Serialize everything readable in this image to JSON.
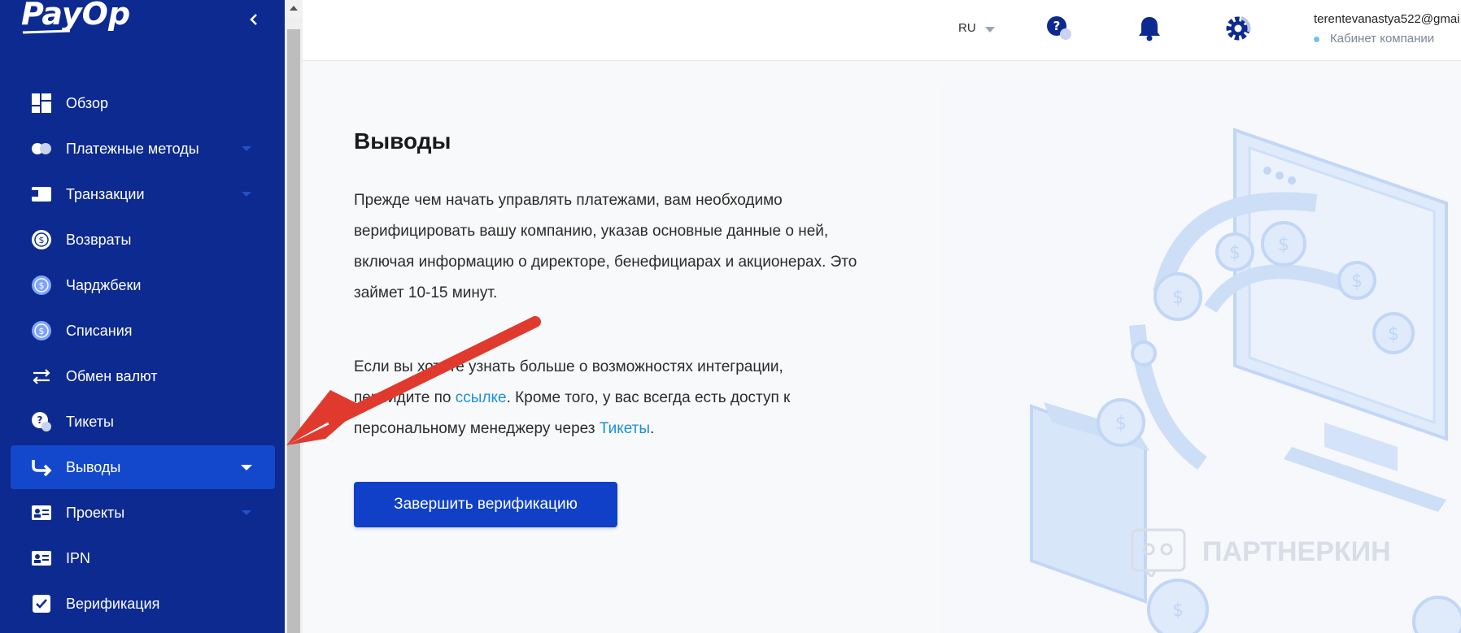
{
  "brand": {
    "logo_text": "PayOp"
  },
  "sidebar": {
    "items": [
      {
        "label": "Обзор",
        "icon": "dashboard-icon",
        "has_caret": false,
        "active": false
      },
      {
        "label": "Платежные методы",
        "icon": "payment-methods-icon",
        "has_caret": true,
        "active": false
      },
      {
        "label": "Транзакции",
        "icon": "wallet-icon",
        "has_caret": true,
        "active": false
      },
      {
        "label": "Возвраты",
        "icon": "refund-icon",
        "has_caret": false,
        "active": false
      },
      {
        "label": "Чарджбеки",
        "icon": "chargeback-icon",
        "has_caret": false,
        "active": false
      },
      {
        "label": "Списания",
        "icon": "writeoff-icon",
        "has_caret": false,
        "active": false
      },
      {
        "label": "Обмен валют",
        "icon": "exchange-icon",
        "has_caret": false,
        "active": false
      },
      {
        "label": "Тикеты",
        "icon": "tickets-icon",
        "has_caret": false,
        "active": false
      },
      {
        "label": "Выводы",
        "icon": "withdrawal-icon",
        "has_caret": true,
        "active": true
      },
      {
        "label": "Проекты",
        "icon": "projects-icon",
        "has_caret": true,
        "active": false
      },
      {
        "label": "IPN",
        "icon": "ipn-icon",
        "has_caret": false,
        "active": false
      },
      {
        "label": "Верификация",
        "icon": "verification-icon",
        "has_caret": false,
        "active": false
      }
    ]
  },
  "header": {
    "language": "RU",
    "user_email": "terentevanastya522@gmai",
    "user_subtitle": "Кабинет компании"
  },
  "main": {
    "title": "Выводы",
    "paragraph1": "Прежде чем начать управлять платежами, вам необходимо верифицировать вашу компанию, указав основные данные о ней, включая информацию о директоре, бенефициарах и акционерах. Это займет 10-15 минут.",
    "paragraph2_before_link": "Если вы хотите узнать больше о возможностях интеграции, перейдите по ",
    "paragraph2_link": "ссылке",
    "paragraph2_middle": ". Кроме того, у вас всегда есть доступ к персональному менеджеру через ",
    "paragraph2_link2": "Тикеты",
    "paragraph2_end": ".",
    "cta_label": "Завершить верификацию"
  },
  "watermark": {
    "text": "ПАРТНЕРКИН"
  },
  "colors": {
    "sidebar_bg": "#0c2a8f",
    "active_item": "#1448cc",
    "cta": "#1040c8",
    "link": "#1d8fd8"
  }
}
